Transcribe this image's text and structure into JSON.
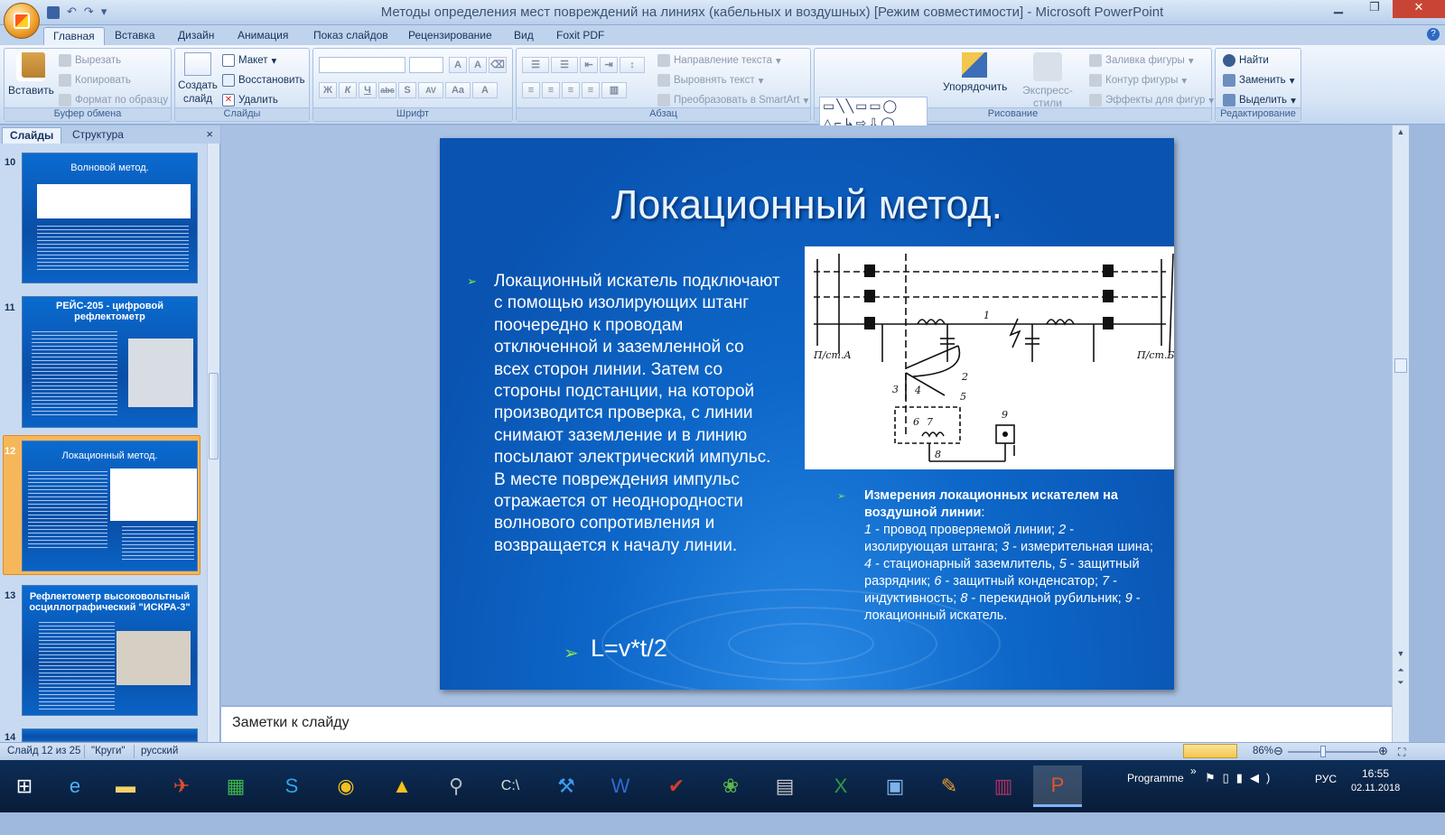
{
  "window": {
    "title": "Методы определения мест повреждений на линиях (кабельных и воздушных) [Режим совместимости] - Microsoft PowerPoint"
  },
  "qat": {
    "undo": "↶",
    "redo": "↷",
    "more": "▾"
  },
  "tabs": [
    "Главная",
    "Вставка",
    "Дизайн",
    "Анимация",
    "Показ слайдов",
    "Рецензирование",
    "Вид",
    "Foxit PDF"
  ],
  "ribbon": {
    "clipboard": {
      "label": "Буфер обмена",
      "paste": "Вставить",
      "cut": "Вырезать",
      "copy": "Копировать",
      "format": "Формат по образцу"
    },
    "slides": {
      "label": "Слайды",
      "create": "Создать слайд",
      "layout": "Макет",
      "reset": "Восстановить",
      "delete": "Удалить"
    },
    "font": {
      "label": "Шрифт",
      "buttons": [
        "Ж",
        "К",
        "Ч",
        "abc",
        "S",
        "AV",
        "Aa",
        "A"
      ]
    },
    "paragraph": {
      "label": "Абзац",
      "text_direction": "Направление текста",
      "align_text": "Выровнять текст",
      "smartart": "Преобразовать в SmartArt"
    },
    "drawing": {
      "label": "Рисование",
      "arrange": "Упорядочить",
      "quick_styles": "Экспресс-стили",
      "fill": "Заливка фигуры",
      "outline": "Контур фигуры",
      "effects": "Эффекты для фигур"
    },
    "editing": {
      "label": "Редактирование",
      "find": "Найти",
      "replace": "Заменить",
      "select": "Выделить"
    }
  },
  "pane": {
    "tab_slides": "Слайды",
    "tab_outline": "Структура",
    "close": "×",
    "thumbs": [
      {
        "num": "10",
        "title": "Волновой метод."
      },
      {
        "num": "11",
        "title": "РЕЙС-205 - цифровой рефлектометр"
      },
      {
        "num": "12",
        "title": "Локационный метод."
      },
      {
        "num": "13",
        "title": "Рефлектометр высоковольтный осциллографический \"ИСКРА-3\""
      },
      {
        "num": "14",
        "title": ""
      }
    ]
  },
  "slide": {
    "title": "Локационный метод.",
    "body": "Локационный искатель подключают с помощью изолирующих штанг поочередно к проводам отключенной и заземленной со всех сторон линии. Затем со стороны подстанции, на которой производится проверка, с линии снимают заземление и в линию посылают электрический импульс. В месте повреждения импульс отражается от неоднородности волнового сопротивления и возвращается к началу линии.",
    "formula": "L=v*t/2",
    "caption_head": "Измерения локационных искателем на воздушной линии",
    "caption_colon": ":",
    "caption_items": [
      {
        "n": "1",
        "t": " - провод проверяемой линии; "
      },
      {
        "n": "2",
        "t": " - изолирующая штанга; "
      },
      {
        "n": "3",
        "t": " - измерительная шина; "
      },
      {
        "n": "4",
        "t": " - стационарный заземлитель, "
      },
      {
        "n": "5",
        "t": " - защитный разрядник; "
      },
      {
        "n": "6",
        "t": " - защитный конденсатор; "
      },
      {
        "n": "7",
        "t": " - индуктивность; "
      },
      {
        "n": "8",
        "t": " - перекидной рубильник; "
      },
      {
        "n": "9",
        "t": " - локационный искатель."
      }
    ],
    "diagram_labels": {
      "sta": "П/ст.А",
      "stb": "П/ст.Б",
      "n1": "1",
      "n2": "2",
      "n3": "3",
      "n4": "4",
      "n5": "5",
      "n6": "6",
      "n7": "7",
      "n8": "8",
      "n9": "9"
    }
  },
  "notes": {
    "placeholder": "Заметки к слайду"
  },
  "status": {
    "slide": "Слайд 12 из 25",
    "theme": "\"Круги\"",
    "lang": "русский",
    "zoom": "86%"
  },
  "tray": {
    "programme": "Programme",
    "chev": "»",
    "lang": "РУС",
    "time": "16:55",
    "date": "02.11.2018"
  },
  "colors": {
    "slide_bg": "#0a53b0",
    "accent_arrow": "#8fe24d",
    "selected_thumb": "#f6b75a"
  }
}
